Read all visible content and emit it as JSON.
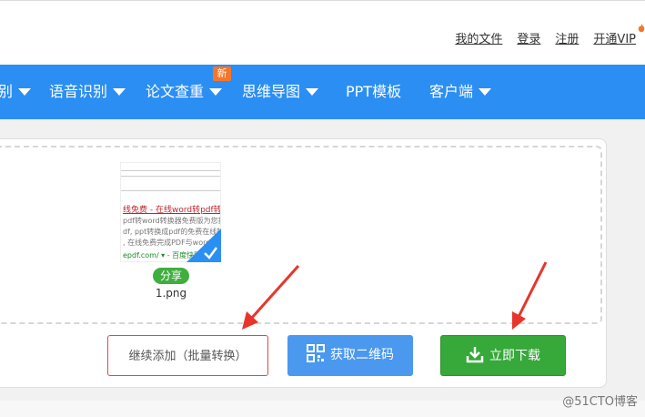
{
  "top_links": {
    "my_files": "我的文件",
    "login": "登录",
    "register": "注册",
    "vip": "开通VIP"
  },
  "nav": {
    "items": [
      {
        "label": "别"
      },
      {
        "label": "语音识别"
      },
      {
        "label": "论文查重"
      },
      {
        "label": "思维导图"
      },
      {
        "label": "PPT模板"
      },
      {
        "label": "客户端"
      }
    ],
    "new_badge": "新"
  },
  "file": {
    "share_label": "分享",
    "name": "1.png",
    "thumb_title": "线免费 - 在线word转pdf转换",
    "thumb_lines": [
      "pdf转word转换器免费版为您提供",
      "df, ppt转换成pdf的免费在线转换",
      ", 在线免费完成PDF与word"
    ],
    "thumb_url": "epdf.com/ ▾ - 百度快照"
  },
  "actions": {
    "add_more": "继续添加（批量转换）",
    "get_qr": "获取二维码",
    "download_now": "立即下载"
  },
  "watermark": "@51CTO博客",
  "colors": {
    "nav_bg": "#2b8ef3",
    "new_badge": "#f5762a",
    "qr_button": "#4b98ef",
    "download_button": "#37a83a",
    "share_badge": "#3fae3f",
    "annotation_arrow": "#e8352b"
  }
}
